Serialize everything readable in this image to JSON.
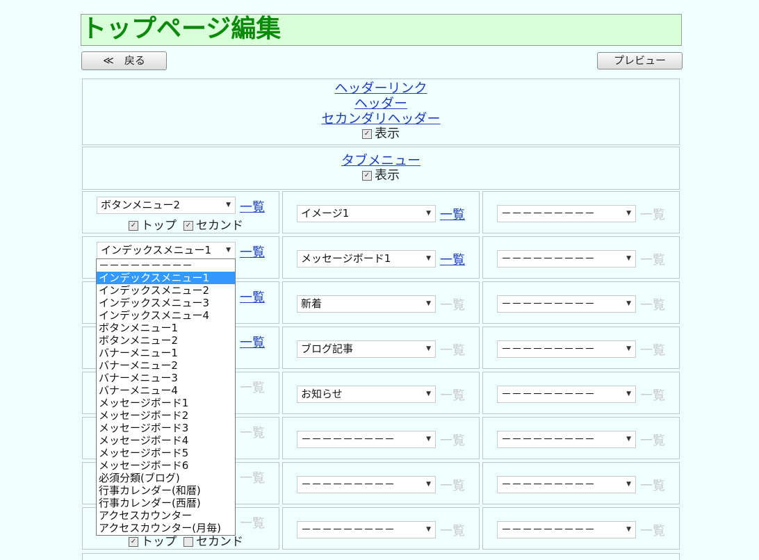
{
  "page": {
    "title": "トップページ編集"
  },
  "toolbar": {
    "back_label": "≪　戻る",
    "preview_label": "プレビュー"
  },
  "header_section": {
    "links": [
      "ヘッダーリンク",
      "ヘッダー",
      "セカンダリヘッダー"
    ],
    "show_label": "表示"
  },
  "tab_section": {
    "link": "タブメニュー",
    "show_label": "表示"
  },
  "grid": {
    "list_label": "一覧",
    "rows": [
      {
        "cols": [
          "ボタンメニュー2",
          "イメージ1",
          "－－－－－－－－－"
        ],
        "enabled": [
          true,
          true,
          false
        ]
      },
      {
        "cols": [
          "インデックスメニュー1",
          "メッセージボード1",
          "－－－－－－－－－"
        ],
        "enabled": [
          true,
          true,
          false
        ]
      },
      {
        "cols": [
          "",
          "新着",
          "－－－－－－－－－"
        ],
        "enabled": [
          true,
          false,
          false
        ]
      },
      {
        "cols": [
          "",
          "ブログ記事",
          "－－－－－－－－－"
        ],
        "enabled": [
          true,
          false,
          false
        ]
      },
      {
        "cols": [
          "",
          "お知らせ",
          "－－－－－－－－－"
        ],
        "enabled": [
          false,
          false,
          false
        ]
      },
      {
        "cols": [
          "",
          "－－－－－－－－－",
          "－－－－－－－－－"
        ],
        "enabled": [
          false,
          false,
          false
        ]
      },
      {
        "cols": [
          "",
          "－－－－－－－－－",
          "－－－－－－－－－"
        ],
        "enabled": [
          false,
          false,
          false
        ]
      },
      {
        "cols": [
          "",
          "－－－－－－－－－",
          "－－－－－－－－－"
        ],
        "enabled": [
          false,
          false,
          false
        ]
      }
    ],
    "top_label": "トップ",
    "second_label": "セカンド"
  },
  "dropdown": {
    "selected_index": 1,
    "options": [
      "－－－－－－－－－",
      "インデックスメニュー1",
      "インデックスメニュー2",
      "インデックスメニュー3",
      "インデックスメニュー4",
      "ボタンメニュー1",
      "ボタンメニュー2",
      "バナーメニュー1",
      "バナーメニュー2",
      "バナーメニュー3",
      "バナーメニュー4",
      "メッセージボード1",
      "メッセージボード2",
      "メッセージボード3",
      "メッセージボード4",
      "メッセージボード5",
      "メッセージボード6",
      "必須分類(ブログ)",
      "行事カレンダー(和暦)",
      "行事カレンダー(西暦)",
      "アクセスカウンター",
      "アクセスカウンター(月毎)"
    ]
  }
}
